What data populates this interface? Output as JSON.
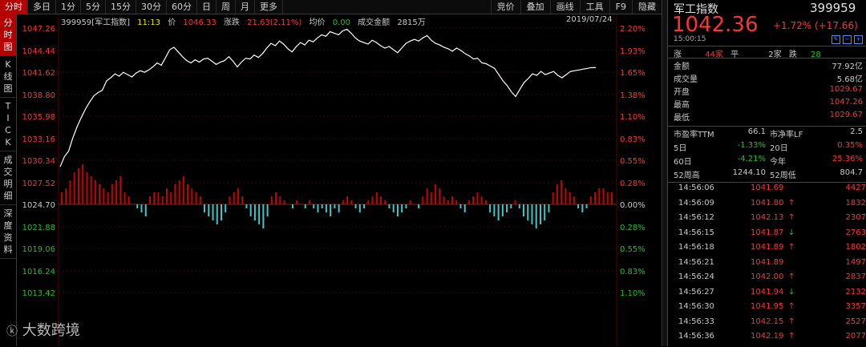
{
  "tabs": [
    "分时",
    "多日",
    "1分",
    "5分",
    "15分",
    "30分",
    "60分",
    "日",
    "周",
    "月",
    "更多"
  ],
  "right_tabs": [
    "竞价",
    "叠加",
    "画线",
    "工具",
    "F9",
    "隐藏"
  ],
  "left_tabs": [
    "分\n时\n图",
    "K\n线\n图",
    "T\nI\nC\nK",
    "成\n交\n明\n细",
    "深\n度\n资\n料"
  ],
  "info": {
    "code_name": "399959[军工指数]",
    "time": "11:13",
    "price_label": "价",
    "price": "1046.33",
    "change_label": "涨跌",
    "change": "21.63(2.11%)",
    "avg_label": "均价",
    "avg": "0.00",
    "amount_label": "成交金额",
    "amount": "2815万",
    "date": "2019/07/24"
  },
  "y_left": [
    "1047.26",
    "1044.44",
    "1041.62",
    "1038.80",
    "1035.98",
    "1033.16",
    "1030.34",
    "1027.52",
    "1024.70",
    "1021.88",
    "1019.06",
    "1016.24",
    "1013.42"
  ],
  "y_right": [
    "2.20%",
    "1.93%",
    "1.65%",
    "1.38%",
    "1.10%",
    "0.83%",
    "0.55%",
    "0.28%",
    "0.00%",
    "0.28%",
    "0.55%",
    "0.83%",
    "1.10%"
  ],
  "chart_data": {
    "type": "line",
    "title": "",
    "base": 1024.7,
    "ylim": [
      1013.42,
      1047.26
    ],
    "line": [
      1029.5,
      1030.8,
      1031.5,
      1033.2,
      1034.6,
      1035.8,
      1036.9,
      1037.8,
      1038.6,
      1039.0,
      1039.3,
      1040.5,
      1040.9,
      1041.4,
      1041.1,
      1041.6,
      1041.3,
      1041.0,
      1041.5,
      1041.8,
      1041.6,
      1041.9,
      1042.3,
      1042.8,
      1042.5,
      1043.5,
      1044.5,
      1044.8,
      1044.2,
      1043.6,
      1043.1,
      1042.8,
      1043.2,
      1042.9,
      1043.3,
      1043.4,
      1043.0,
      1042.6,
      1042.9,
      1043.1,
      1043.6,
      1043.0,
      1042.3,
      1042.9,
      1043.4,
      1043.3,
      1043.8,
      1043.5,
      1044.0,
      1044.7,
      1045.3,
      1045.0,
      1045.6,
      1045.2,
      1044.6,
      1044.2,
      1044.9,
      1045.4,
      1045.1,
      1045.7,
      1045.5,
      1046.0,
      1046.4,
      1046.2,
      1046.8,
      1046.6,
      1046.4,
      1046.9,
      1047.1,
      1046.6,
      1046.0,
      1045.6,
      1045.4,
      1045.2,
      1045.7,
      1045.4,
      1045.0,
      1044.7,
      1044.9,
      1044.5,
      1044.1,
      1044.7,
      1045.3,
      1045.6,
      1045.8,
      1045.6,
      1046.0,
      1046.3,
      1045.7,
      1045.3,
      1045.1,
      1044.8,
      1044.6,
      1044.3,
      1044.7,
      1044.4,
      1044.0,
      1043.7,
      1043.3,
      1043.4,
      1042.8,
      1042.7,
      1042.4,
      1042.1,
      1041.3,
      1040.5,
      1039.9,
      1039.1,
      1038.5,
      1039.4,
      1040.3,
      1040.8,
      1041.4,
      1041.2,
      1041.7,
      1041.3,
      1041.5,
      1041.7,
      1041.2,
      1040.9,
      1041.3,
      1041.7,
      1041.8,
      1041.9,
      1042.0,
      1042.1,
      1042.2,
      1042.19
    ],
    "bars": [
      3,
      4,
      6,
      8,
      9,
      10,
      8,
      7,
      6,
      5,
      4,
      3,
      5,
      6,
      7,
      3,
      2,
      0,
      -1,
      -2,
      -3,
      2,
      3,
      3,
      2,
      4,
      3,
      5,
      6,
      7,
      5,
      4,
      3,
      2,
      -2,
      -3,
      -4,
      -5,
      -4,
      -2,
      2,
      3,
      4,
      2,
      -1,
      -3,
      -4,
      -5,
      -6,
      -3,
      2,
      3,
      2,
      1,
      0,
      -1,
      1,
      0,
      -1,
      1,
      -1,
      -2,
      -1,
      -2,
      -3,
      -1,
      -2,
      1,
      2,
      1,
      -1,
      -2,
      -1,
      1,
      2,
      3,
      2,
      1,
      -1,
      -2,
      -3,
      -2,
      -1,
      1,
      0,
      -1,
      2,
      4,
      3,
      5,
      4,
      2,
      1,
      2,
      1,
      -1,
      -2,
      1,
      2,
      3,
      2,
      1,
      -2,
      -3,
      -4,
      -3,
      -2,
      -1,
      1,
      -1,
      -3,
      -4,
      -5,
      -6,
      -5,
      -4,
      -2,
      3,
      5,
      6,
      4,
      3,
      2,
      -1,
      -2,
      -1,
      2,
      3,
      4,
      4,
      3,
      3
    ],
    "vol_scale": 10
  },
  "panel": {
    "name": "军工指数",
    "code": "399959",
    "price": "1042.36",
    "change": "+1.72% (+17.66)",
    "time": "15:00:15",
    "breadth": {
      "up_label": "涨",
      "up": "44家",
      "flat_label": "平",
      "flat": "2家",
      "down_label": "跌",
      "down": "28"
    },
    "stats": [
      {
        "label": "金额",
        "value": "77.92亿"
      },
      {
        "label": "成交量",
        "value": "5.68亿"
      },
      {
        "label": "开盘",
        "value": "1029.67"
      },
      {
        "label": "最高",
        "value": "1047.26"
      },
      {
        "label": "最低",
        "value": "1029.67"
      }
    ],
    "ratios": [
      {
        "l1": "市盈率TTM",
        "v1": "66.1",
        "l2": "市净率LF",
        "v2": "2.5"
      },
      {
        "l1": "5日",
        "v1": "-1.33%",
        "l2": "20日",
        "v2": "0.35%"
      },
      {
        "l1": "60日",
        "v1": "-4.21%",
        "l2": "今年",
        "v2": "25.36%"
      },
      {
        "l1": "52周高",
        "v1": "1244.10",
        "l2": "52周低",
        "v2": "804.7"
      }
    ],
    "ticks": [
      {
        "time": "14:56:06",
        "price": "1041.69",
        "arrow": "",
        "vol": "4427"
      },
      {
        "time": "14:56:09",
        "price": "1041.80",
        "arrow": "up",
        "vol": "1832"
      },
      {
        "time": "14:56:12",
        "price": "1042.13",
        "arrow": "up",
        "vol": "2307"
      },
      {
        "time": "14:56:15",
        "price": "1041.87",
        "arrow": "down",
        "vol": "2763"
      },
      {
        "time": "14:56:18",
        "price": "1041.89",
        "arrow": "up",
        "vol": "1802"
      },
      {
        "time": "14:56:21",
        "price": "1041.89",
        "arrow": "",
        "vol": "1497"
      },
      {
        "time": "14:56:24",
        "price": "1042.00",
        "arrow": "up",
        "vol": "2837"
      },
      {
        "time": "14:56:27",
        "price": "1041.94",
        "arrow": "down",
        "vol": "2132"
      },
      {
        "time": "14:56:30",
        "price": "1041.95",
        "arrow": "up",
        "vol": "3357"
      },
      {
        "time": "14:56:33",
        "price": "1042.15",
        "arrow": "up",
        "vol": "2527"
      },
      {
        "time": "14:56:36",
        "price": "1042.19",
        "arrow": "up",
        "vol": "2077"
      }
    ]
  },
  "watermark": "大数跨境",
  "colors": {
    "up": "#ff3232",
    "down": "#1fc21f",
    "bar_up": "#c80000",
    "bar_down": "#33cccc",
    "line": "#ffffff"
  }
}
